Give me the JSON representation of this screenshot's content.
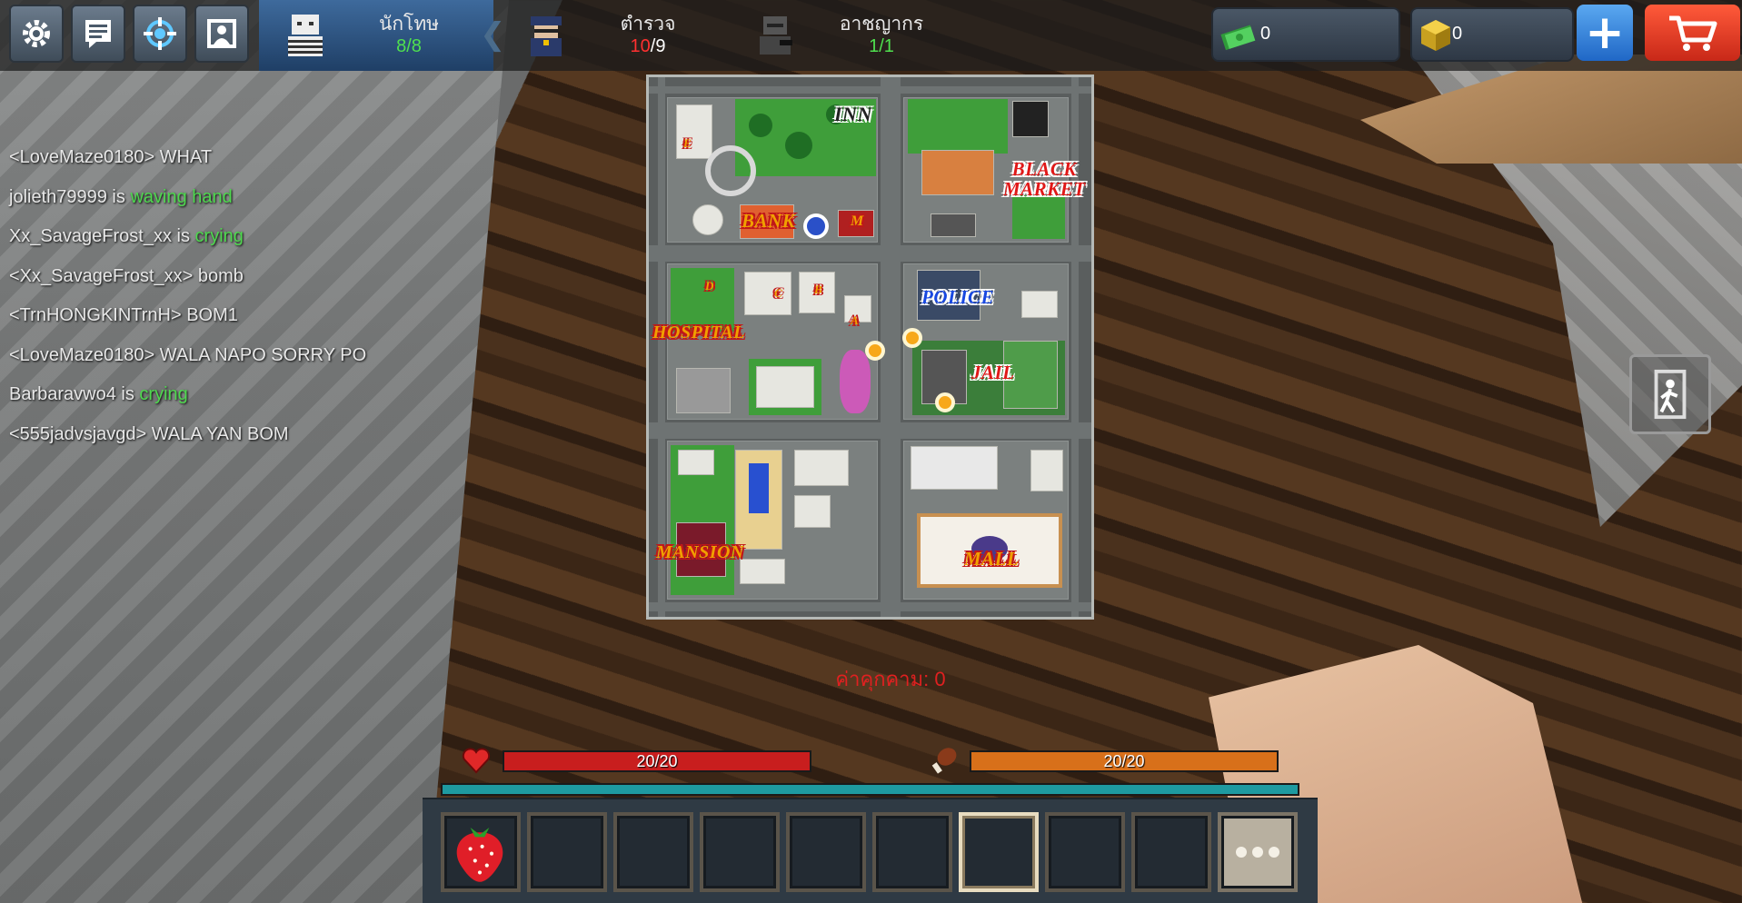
{
  "toolbar": {
    "buttons": [
      {
        "icon": "gear-icon"
      },
      {
        "icon": "chat-icon"
      },
      {
        "icon": "target-icon"
      },
      {
        "icon": "profile-icon"
      }
    ]
  },
  "teams": [
    {
      "label": "นักโทษ",
      "current": "8",
      "sep": "/",
      "max": "8",
      "active": true,
      "current_color": "green"
    },
    {
      "label": "ตำรวจ",
      "current": "10",
      "sep": "/",
      "max": "9",
      "active": false,
      "current_color": "red"
    },
    {
      "label": "อาชญากร",
      "current": "1",
      "sep": "/",
      "max": "1",
      "active": false,
      "current_color": "green"
    }
  ],
  "currency": {
    "cash": "0",
    "gold": "0"
  },
  "chat": [
    {
      "text": "<LoveMaze0180> WHAT",
      "emote": ""
    },
    {
      "text": "jolieth79999 is ",
      "emote": "waving hand"
    },
    {
      "text": "Xx_SavageFrost_xx is ",
      "emote": "crying"
    },
    {
      "text": "<Xx_SavageFrost_xx> bomb",
      "emote": ""
    },
    {
      "text": "<TrnHONGKINTrnH> BOM1",
      "emote": ""
    },
    {
      "text": "<LoveMaze0180> WALA NAPO SORRY PO",
      "emote": ""
    },
    {
      "text": "Barbaravwo4 is ",
      "emote": "crying"
    },
    {
      "text": "<555jadvsjavgd> WALA YAN BOM",
      "emote": ""
    }
  ],
  "map": {
    "labels": {
      "inn": "INN",
      "black_market_1": "BLACK",
      "black_market_2": "MARKET",
      "bank": "BANK",
      "police": "POLICE",
      "hospital": "HOSPITAL",
      "jail": "JAIL",
      "mansion": "MANSION",
      "mall": "MALL",
      "m_sign": "M",
      "house_a": "A",
      "house_b": "B",
      "house_c": "C",
      "house_d": "D",
      "house_e": "E"
    }
  },
  "karma": "ค่าคุกคาม: 0",
  "status": {
    "health": "20/20",
    "hunger": "20/20"
  },
  "hotbar": {
    "slots": [
      "strawberry",
      "",
      "",
      "",
      "",
      "",
      "",
      "",
      ""
    ],
    "selected_index": 6,
    "more_icon": "more-dots-icon"
  },
  "colors": {
    "health": "#c81e1e",
    "hunger": "#d8701a",
    "xp": "#1e9aa0",
    "team_active": "#2b5585",
    "cart": "#d83620",
    "plus": "#2b7bd8"
  }
}
